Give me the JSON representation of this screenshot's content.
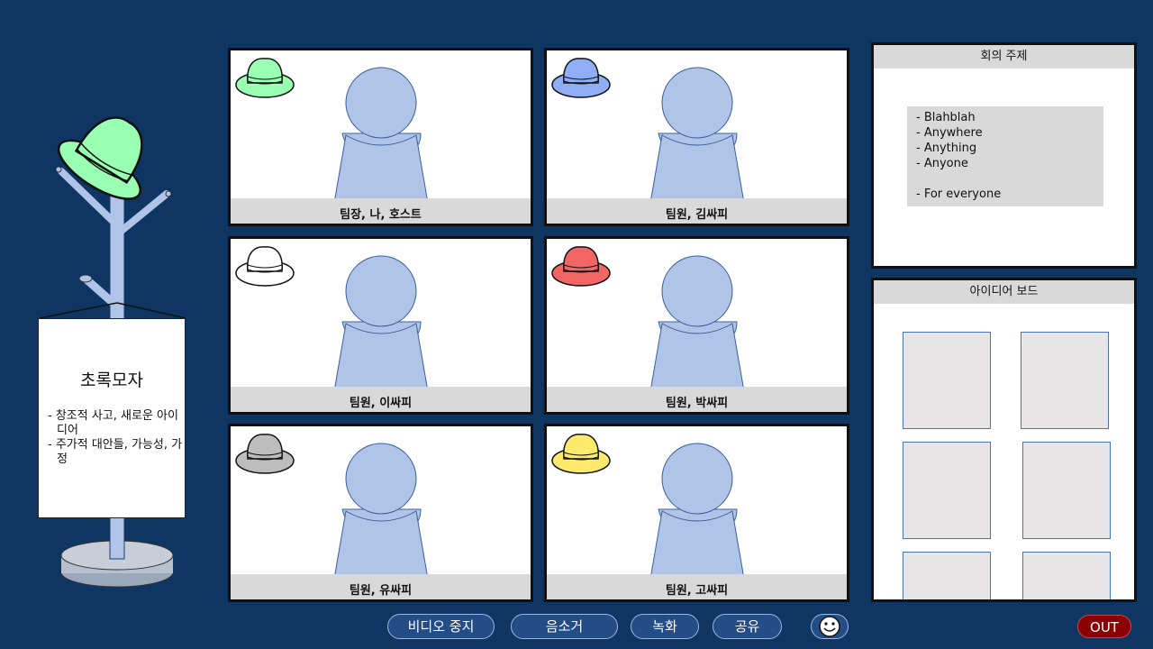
{
  "hat_rack": {
    "hat_color": "#99ffb3",
    "card_title": "초록모자",
    "card_points": [
      "- 창조적 사고, 새로운 아이디어",
      "- 주가적 대안들, 가능성, 가정"
    ]
  },
  "participants": [
    {
      "name": "팀장, 나, 호스트",
      "hat_color": "#99ffb3",
      "hat_icon": "green-hat-icon"
    },
    {
      "name": "팀원, 김싸피",
      "hat_color": "#8faef6",
      "hat_icon": "blue-hat-icon"
    },
    {
      "name": "팀원, 이싸피",
      "hat_color": "#ffffff",
      "hat_icon": "white-hat-icon"
    },
    {
      "name": "팀원, 박싸피",
      "hat_color": "#f26565",
      "hat_icon": "red-hat-icon"
    },
    {
      "name": "팀원, 유싸피",
      "hat_color": "#bdbdbd",
      "hat_icon": "gray-hat-icon"
    },
    {
      "name": "팀원, 고싸피",
      "hat_color": "#fde96a",
      "hat_icon": "yellow-hat-icon"
    }
  ],
  "agenda": {
    "title": "회의 주제",
    "items": [
      "-   Blahblah",
      "-   Anywhere",
      "-   Anything",
      "-   Anyone",
      "-   For everyone"
    ]
  },
  "idea_board": {
    "title": "아이디어 보드",
    "note_count": 6
  },
  "toolbar": {
    "stop_video": "비디오 중지",
    "mute": "음소거",
    "record": "녹화",
    "share": "공유",
    "reaction_icon": "smiley-icon",
    "out": "OUT"
  },
  "colors": {
    "background": "#0f3563",
    "avatar": "#b0c4e8",
    "button": "#244c87",
    "out": "#8b0000"
  }
}
